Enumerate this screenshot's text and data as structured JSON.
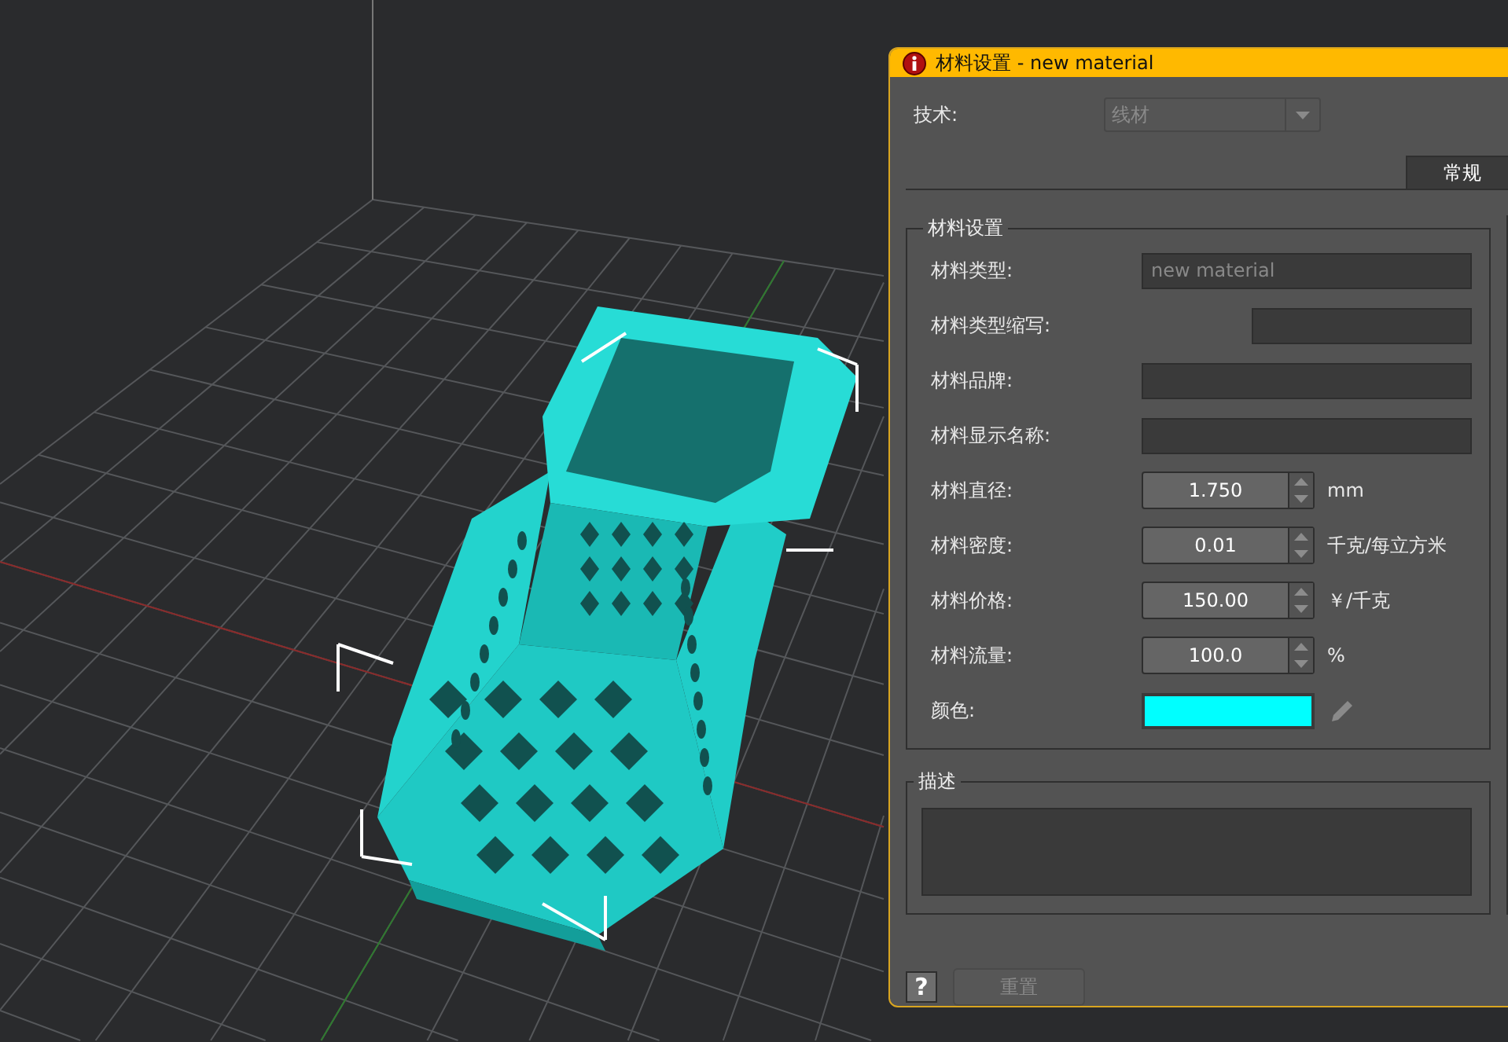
{
  "window": {
    "title": "材料设置 - new material"
  },
  "technology": {
    "label": "技术:",
    "value": "线材",
    "disabled": true
  },
  "tabs": [
    {
      "label": "常规",
      "selected": true
    }
  ],
  "material_settings": {
    "title": "材料设置",
    "fields": [
      {
        "kind": "text",
        "label": "材料类型:",
        "placeholder": "new material"
      },
      {
        "kind": "short_text",
        "label": "材料类型缩写:"
      },
      {
        "kind": "text",
        "label": "材料品牌:"
      },
      {
        "kind": "text",
        "label": "材料显示名称:"
      },
      {
        "kind": "spin",
        "label": "材料直径:",
        "value": "1.750",
        "unit": "mm"
      },
      {
        "kind": "spin",
        "label": "材料密度:",
        "value": "0.01",
        "unit": "千克/每立方米"
      },
      {
        "kind": "spin",
        "label": "材料价格:",
        "value": "150.00",
        "unit": "￥/千克"
      },
      {
        "kind": "spin",
        "label": "材料流量:",
        "value": "100.0",
        "unit": "%"
      },
      {
        "kind": "color",
        "label": "颜色:",
        "color": "#00ffff"
      }
    ]
  },
  "description": {
    "title": "描述"
  },
  "buttons": [
    {
      "kind": "help",
      "label": "?",
      "disabled": false
    },
    {
      "kind": "reset",
      "label": "重置",
      "disabled": true
    }
  ]
}
